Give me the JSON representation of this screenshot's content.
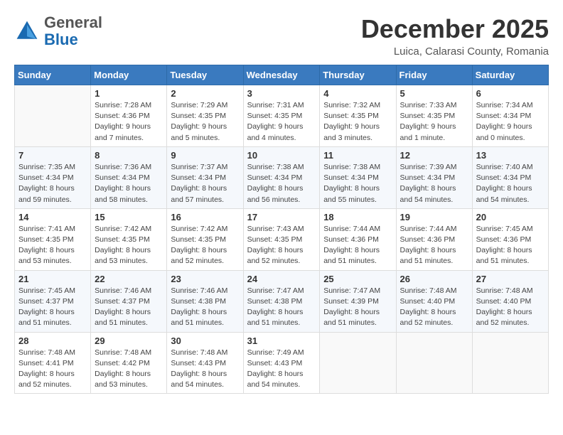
{
  "logo": {
    "general": "General",
    "blue": "Blue"
  },
  "title": {
    "month": "December 2025",
    "location": "Luica, Calarasi County, Romania"
  },
  "headers": [
    "Sunday",
    "Monday",
    "Tuesday",
    "Wednesday",
    "Thursday",
    "Friday",
    "Saturday"
  ],
  "weeks": [
    [
      {
        "day": "",
        "info": ""
      },
      {
        "day": "1",
        "info": "Sunrise: 7:28 AM\nSunset: 4:36 PM\nDaylight: 9 hours\nand 7 minutes."
      },
      {
        "day": "2",
        "info": "Sunrise: 7:29 AM\nSunset: 4:35 PM\nDaylight: 9 hours\nand 5 minutes."
      },
      {
        "day": "3",
        "info": "Sunrise: 7:31 AM\nSunset: 4:35 PM\nDaylight: 9 hours\nand 4 minutes."
      },
      {
        "day": "4",
        "info": "Sunrise: 7:32 AM\nSunset: 4:35 PM\nDaylight: 9 hours\nand 3 minutes."
      },
      {
        "day": "5",
        "info": "Sunrise: 7:33 AM\nSunset: 4:35 PM\nDaylight: 9 hours\nand 1 minute."
      },
      {
        "day": "6",
        "info": "Sunrise: 7:34 AM\nSunset: 4:34 PM\nDaylight: 9 hours\nand 0 minutes."
      }
    ],
    [
      {
        "day": "7",
        "info": "Sunrise: 7:35 AM\nSunset: 4:34 PM\nDaylight: 8 hours\nand 59 minutes."
      },
      {
        "day": "8",
        "info": "Sunrise: 7:36 AM\nSunset: 4:34 PM\nDaylight: 8 hours\nand 58 minutes."
      },
      {
        "day": "9",
        "info": "Sunrise: 7:37 AM\nSunset: 4:34 PM\nDaylight: 8 hours\nand 57 minutes."
      },
      {
        "day": "10",
        "info": "Sunrise: 7:38 AM\nSunset: 4:34 PM\nDaylight: 8 hours\nand 56 minutes."
      },
      {
        "day": "11",
        "info": "Sunrise: 7:38 AM\nSunset: 4:34 PM\nDaylight: 8 hours\nand 55 minutes."
      },
      {
        "day": "12",
        "info": "Sunrise: 7:39 AM\nSunset: 4:34 PM\nDaylight: 8 hours\nand 54 minutes."
      },
      {
        "day": "13",
        "info": "Sunrise: 7:40 AM\nSunset: 4:34 PM\nDaylight: 8 hours\nand 54 minutes."
      }
    ],
    [
      {
        "day": "14",
        "info": "Sunrise: 7:41 AM\nSunset: 4:35 PM\nDaylight: 8 hours\nand 53 minutes."
      },
      {
        "day": "15",
        "info": "Sunrise: 7:42 AM\nSunset: 4:35 PM\nDaylight: 8 hours\nand 53 minutes."
      },
      {
        "day": "16",
        "info": "Sunrise: 7:42 AM\nSunset: 4:35 PM\nDaylight: 8 hours\nand 52 minutes."
      },
      {
        "day": "17",
        "info": "Sunrise: 7:43 AM\nSunset: 4:35 PM\nDaylight: 8 hours\nand 52 minutes."
      },
      {
        "day": "18",
        "info": "Sunrise: 7:44 AM\nSunset: 4:36 PM\nDaylight: 8 hours\nand 51 minutes."
      },
      {
        "day": "19",
        "info": "Sunrise: 7:44 AM\nSunset: 4:36 PM\nDaylight: 8 hours\nand 51 minutes."
      },
      {
        "day": "20",
        "info": "Sunrise: 7:45 AM\nSunset: 4:36 PM\nDaylight: 8 hours\nand 51 minutes."
      }
    ],
    [
      {
        "day": "21",
        "info": "Sunrise: 7:45 AM\nSunset: 4:37 PM\nDaylight: 8 hours\nand 51 minutes."
      },
      {
        "day": "22",
        "info": "Sunrise: 7:46 AM\nSunset: 4:37 PM\nDaylight: 8 hours\nand 51 minutes."
      },
      {
        "day": "23",
        "info": "Sunrise: 7:46 AM\nSunset: 4:38 PM\nDaylight: 8 hours\nand 51 minutes."
      },
      {
        "day": "24",
        "info": "Sunrise: 7:47 AM\nSunset: 4:38 PM\nDaylight: 8 hours\nand 51 minutes."
      },
      {
        "day": "25",
        "info": "Sunrise: 7:47 AM\nSunset: 4:39 PM\nDaylight: 8 hours\nand 51 minutes."
      },
      {
        "day": "26",
        "info": "Sunrise: 7:48 AM\nSunset: 4:40 PM\nDaylight: 8 hours\nand 52 minutes."
      },
      {
        "day": "27",
        "info": "Sunrise: 7:48 AM\nSunset: 4:40 PM\nDaylight: 8 hours\nand 52 minutes."
      }
    ],
    [
      {
        "day": "28",
        "info": "Sunrise: 7:48 AM\nSunset: 4:41 PM\nDaylight: 8 hours\nand 52 minutes."
      },
      {
        "day": "29",
        "info": "Sunrise: 7:48 AM\nSunset: 4:42 PM\nDaylight: 8 hours\nand 53 minutes."
      },
      {
        "day": "30",
        "info": "Sunrise: 7:48 AM\nSunset: 4:43 PM\nDaylight: 8 hours\nand 54 minutes."
      },
      {
        "day": "31",
        "info": "Sunrise: 7:49 AM\nSunset: 4:43 PM\nDaylight: 8 hours\nand 54 minutes."
      },
      {
        "day": "",
        "info": ""
      },
      {
        "day": "",
        "info": ""
      },
      {
        "day": "",
        "info": ""
      }
    ]
  ]
}
